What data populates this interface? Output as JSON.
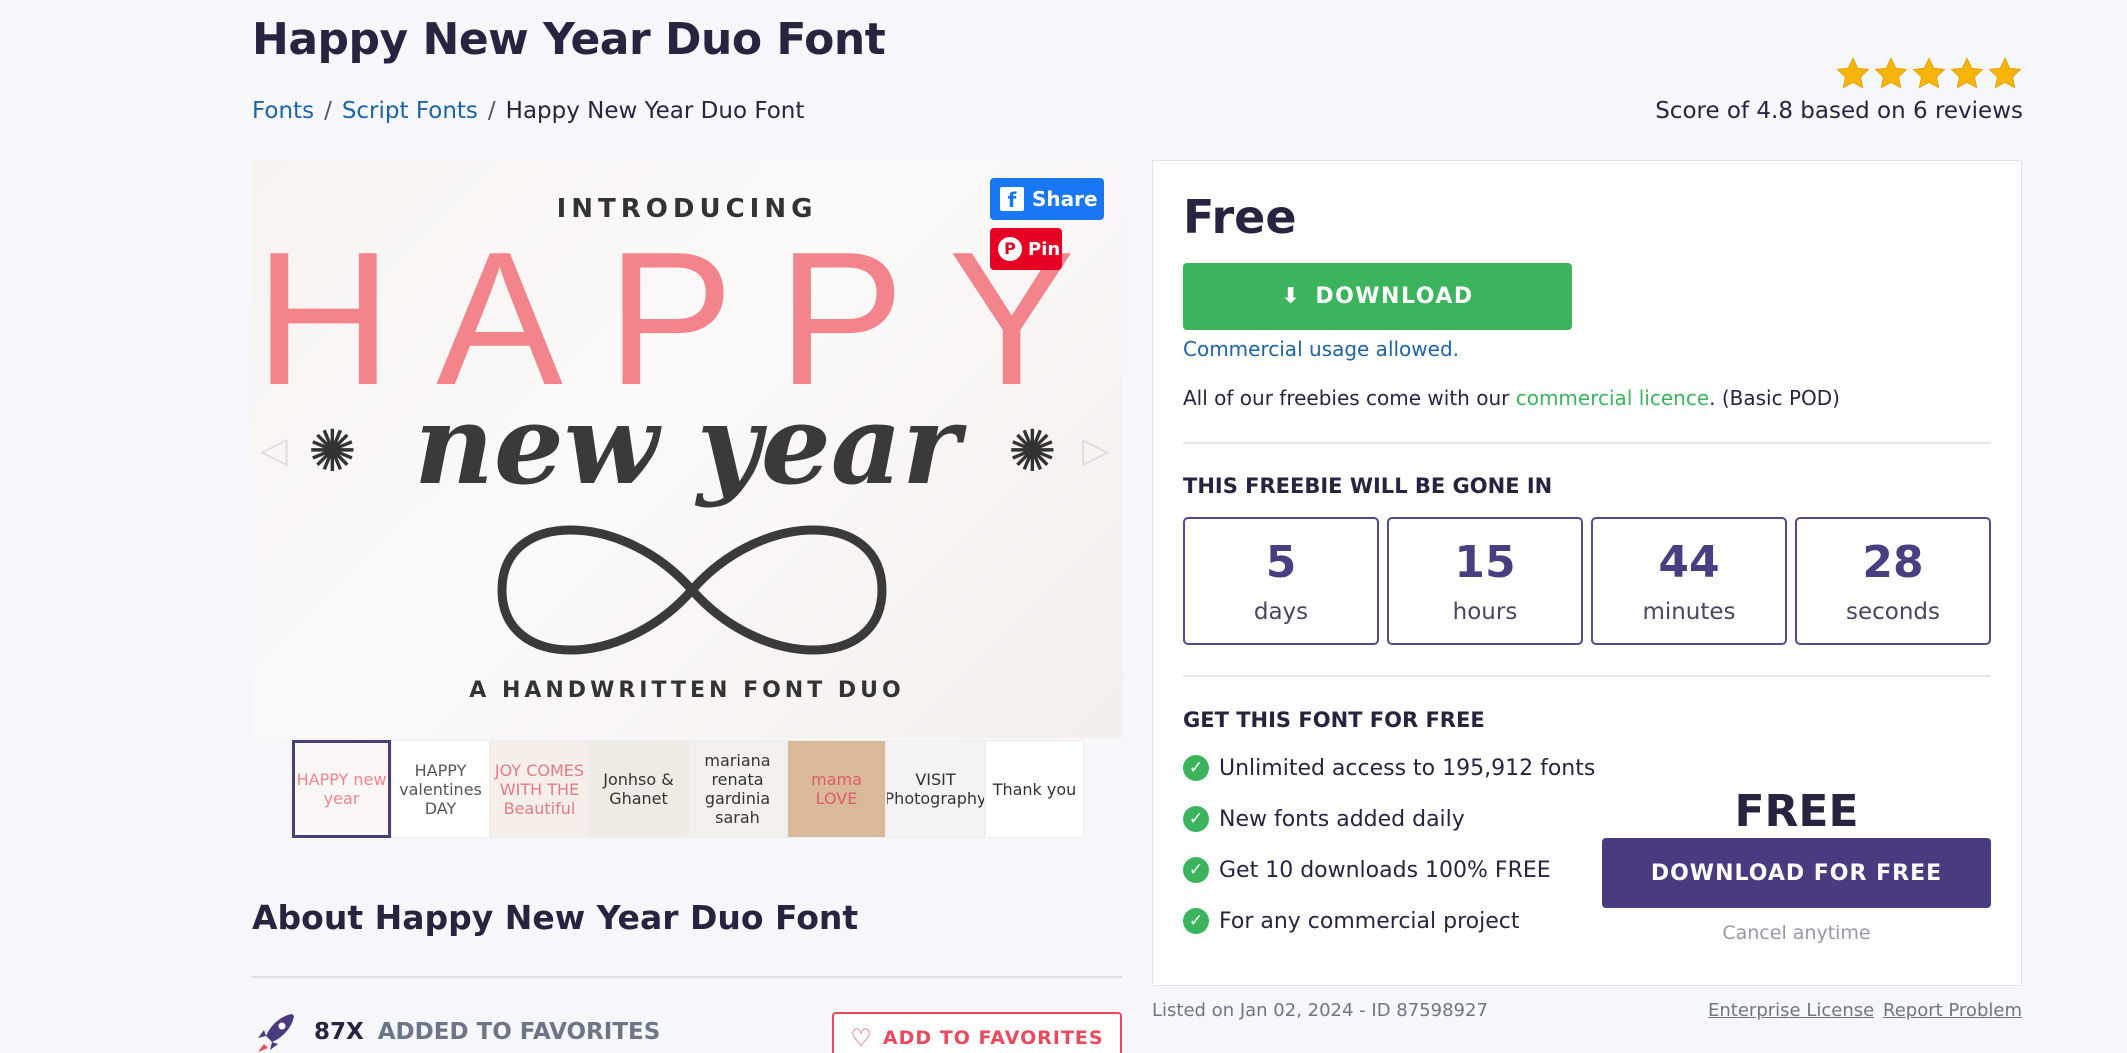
{
  "page": {
    "title": "Happy New Year Duo Font",
    "breadcrumb": [
      {
        "label": "Fonts"
      },
      {
        "label": "Script Fonts"
      },
      {
        "label": "Happy New Year Duo Font"
      }
    ],
    "breadcrumb_sep": "/",
    "rating": {
      "stars": 5,
      "score_text": "Score of 4.8 based on 6 reviews",
      "star_color": "#f7b50c"
    }
  },
  "hero": {
    "introducing": "INTRODUCING",
    "happy": "HAPPY",
    "new_year": "new year",
    "tagline": "A HANDWRITTEN FONT DUO",
    "share_label": "Share",
    "fb_glyph": "f",
    "pin_label": "Pin",
    "pin_glyph": "P",
    "prev_arrow": "◁",
    "next_arrow": "▷",
    "flower_glyph": "✺"
  },
  "thumbnails": [
    {
      "text": "HAPPY new year"
    },
    {
      "text": "HAPPY valentines DAY"
    },
    {
      "text": "JOY COMES WITH THE Beautiful"
    },
    {
      "text": "Jonhso & Ghanet"
    },
    {
      "text": "mariana renata gardinia sarah"
    },
    {
      "text": "mama LOVE"
    },
    {
      "text": "VISIT Photography"
    },
    {
      "text": "Thank you"
    }
  ],
  "about": {
    "title": "About Happy New Year Duo Font",
    "fav_count": "87X",
    "fav_label": "ADDED TO FAVORITES",
    "add_fav_label": "ADD TO FAVORITES",
    "heart_glyph": "♡"
  },
  "panel": {
    "price": "Free",
    "download_label": "DOWNLOAD",
    "download_glyph": "⬇",
    "commercial_usage": "Commercial usage allowed.",
    "freebies_prefix": "All of our freebies come with our ",
    "licence_link": "commercial licence",
    "freebies_suffix": ". (Basic POD)",
    "gone_title": "THIS FREEBIE WILL BE GONE IN",
    "timer": [
      {
        "value": "5",
        "unit": "days"
      },
      {
        "value": "15",
        "unit": "hours"
      },
      {
        "value": "44",
        "unit": "minutes"
      },
      {
        "value": "28",
        "unit": "seconds"
      }
    ],
    "get_font_title": "GET THIS FONT FOR FREE",
    "check_glyph": "✓",
    "features": [
      "Unlimited access to 195,912 fonts",
      "New fonts added daily",
      "Get 10 downloads 100% FREE",
      "For any commercial project"
    ],
    "free_big": "FREE",
    "download_free_label": "DOWNLOAD FOR FREE",
    "cancel_label": "Cancel anytime"
  },
  "footer": {
    "listed": "Listed on Jan 02, 2024 - ID 87598927",
    "enterprise": "Enterprise License",
    "report": "Report Problem"
  },
  "colors": {
    "brand_purple": "#4a3b80",
    "green": "#3cb45e",
    "link_blue": "#1e63a8",
    "red": "#e84b5d"
  }
}
